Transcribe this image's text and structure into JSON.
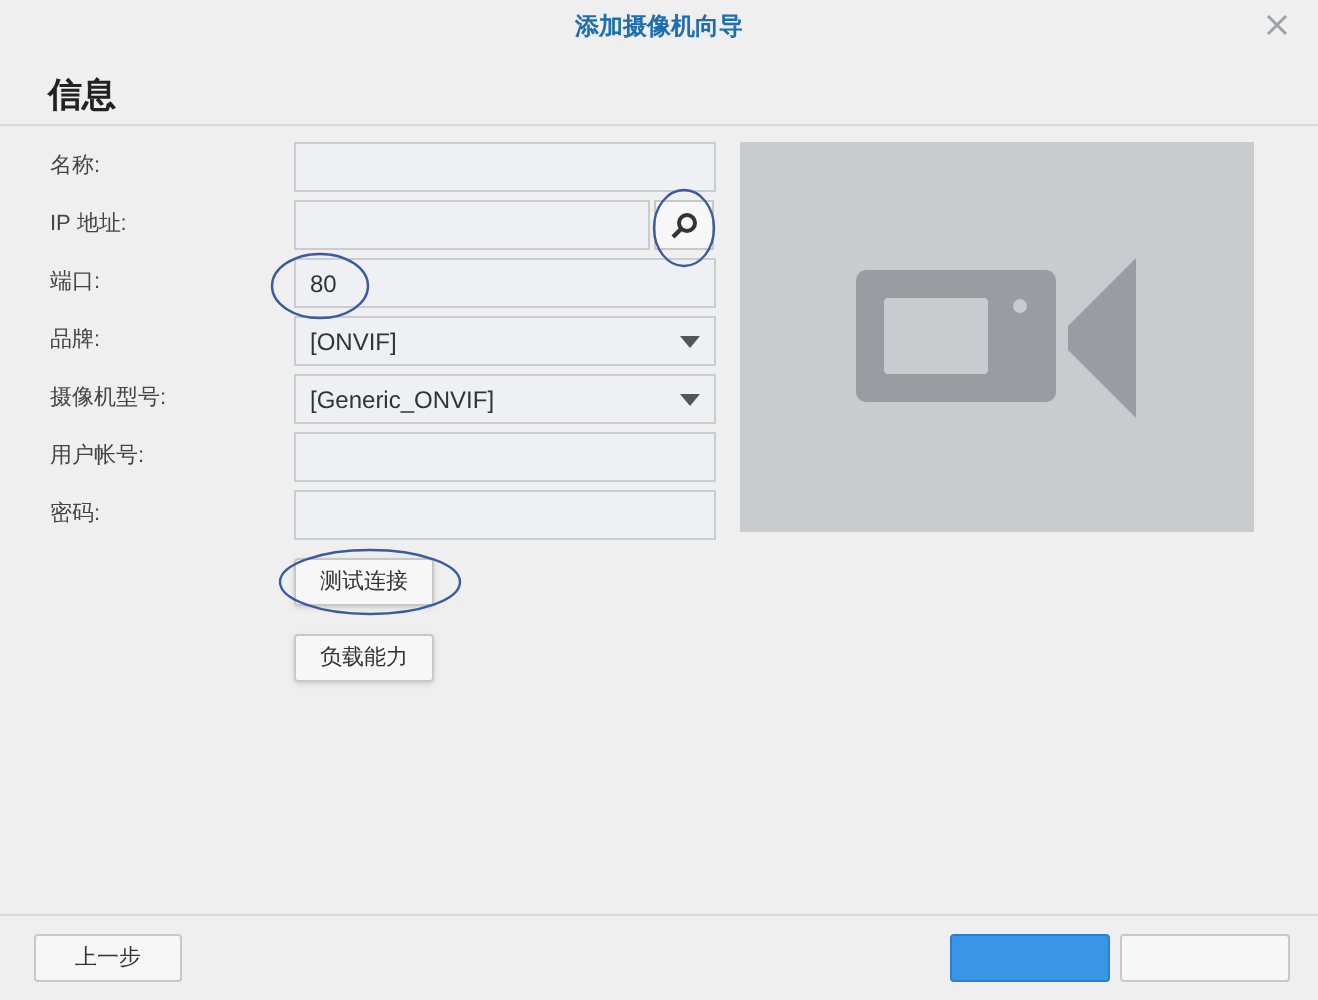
{
  "window": {
    "title": "添加摄像机向导"
  },
  "heading": "信息",
  "fields": [
    {
      "kind": "text",
      "label": "名称:"
    },
    {
      "kind": "search",
      "label": "IP 地址:"
    },
    {
      "kind": "text",
      "label": "端口:",
      "value": "80"
    },
    {
      "kind": "select",
      "label": "品牌:",
      "value": "[ONVIF]"
    },
    {
      "kind": "select",
      "label": "摄像机型号:",
      "value": "[Generic_ONVIF]"
    },
    {
      "kind": "text",
      "label": "用户帐号:"
    },
    {
      "kind": "text",
      "label": "密码:"
    }
  ],
  "actions": [
    "测试连接",
    "负载能力"
  ],
  "footer": {
    "back": "上一步",
    "buttons": [
      {
        "kind": "primary"
      },
      {
        "kind": "secondary"
      }
    ]
  }
}
